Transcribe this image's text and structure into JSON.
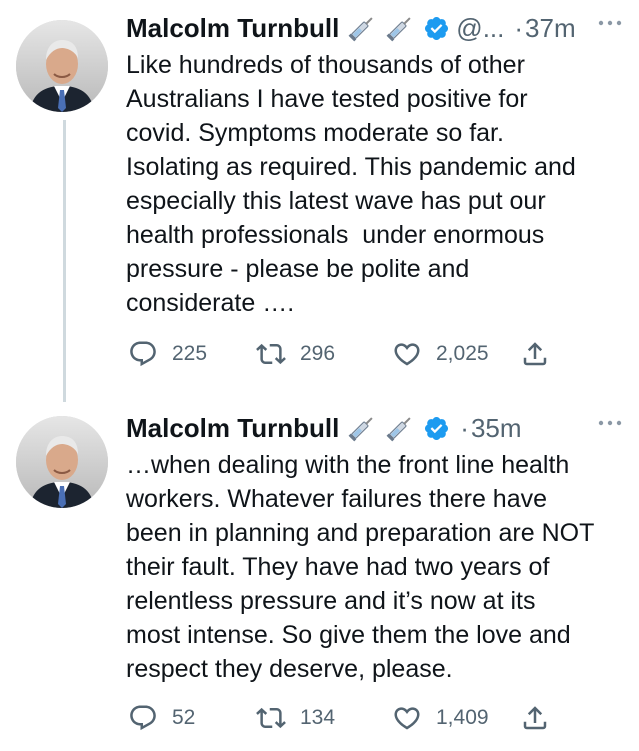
{
  "tweets": [
    {
      "author_name": "Malcolm Turnbull",
      "handle": "@...",
      "separator": "·",
      "time": "37m",
      "text": "Like hundreds of thousands of other\nAustralians I have tested positive for\ncovid. Symptoms moderate so far.\nIsolating as required. This pandemic and\nespecially this latest wave has put our\nhealth professionals  under enormous\npressure - please be polite and\nconsiderate ….",
      "replies": "225",
      "retweets": "296",
      "likes": "2,025"
    },
    {
      "author_name": "Malcolm Turnbull",
      "handle": "",
      "separator": "·",
      "time": "35m",
      "text": "…when dealing with the front line health\nworkers. Whatever failures there have\nbeen in planning and preparation are NOT\ntheir fault. They have had two years of\nrelentless pressure and it’s now at its\nmost intense. So give them the love and\nrespect they deserve, please.",
      "replies": "52",
      "retweets": "134",
      "likes": "1,409"
    }
  ],
  "icons": {
    "emoji": "syringe-icon",
    "badge": "verified-badge-icon",
    "more": "more-dots-icon",
    "reply": "reply-icon",
    "retweet": "retweet-icon",
    "like": "heart-icon",
    "share": "share-icon"
  },
  "colors": {
    "text": "#0f1419",
    "secondary": "#536471",
    "verified": "#1d9bf0",
    "thread_line": "#cfd9de"
  }
}
